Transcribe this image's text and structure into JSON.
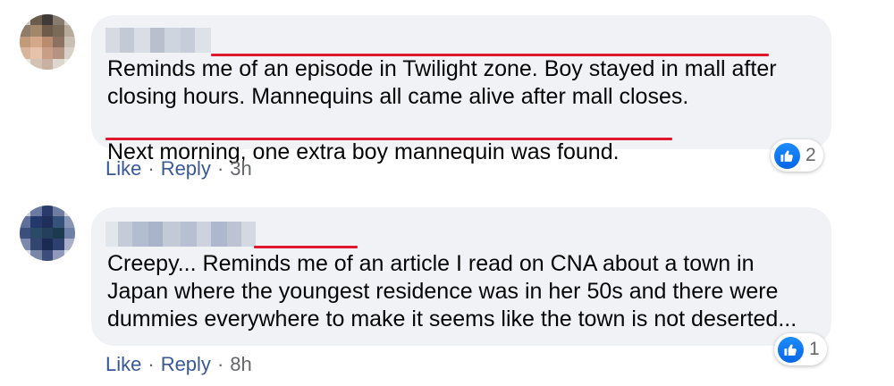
{
  "comments": [
    {
      "before": "",
      "highlight": "Reminds me of an episode in Twilight zone.",
      "rest": " Boy stayed in mall after closing hours. Mannequins all came alive after mall closes.",
      "highlight2": "Next morning, one extra boy mannequin was found.",
      "reaction_count": "2",
      "like": "Like",
      "reply": "Reply",
      "time": "3h"
    },
    {
      "highlight": "Creepy...",
      "rest": " Reminds me of an article I read on CNA about a town in Japan where the youngest residence was in her 50s and there were dummies everywhere to make it seems like the town is not deserted...",
      "reaction_count": "1",
      "like": "Like",
      "reply": "Reply",
      "time": "8h"
    }
  ],
  "icons": {
    "reaction": "thumbs-up-icon"
  },
  "colors": {
    "bubble": "#f0f2f5",
    "underline": "#e0182d",
    "like_blue": "#1877f2",
    "action_text": "#385898",
    "meta_text": "#65676b"
  }
}
